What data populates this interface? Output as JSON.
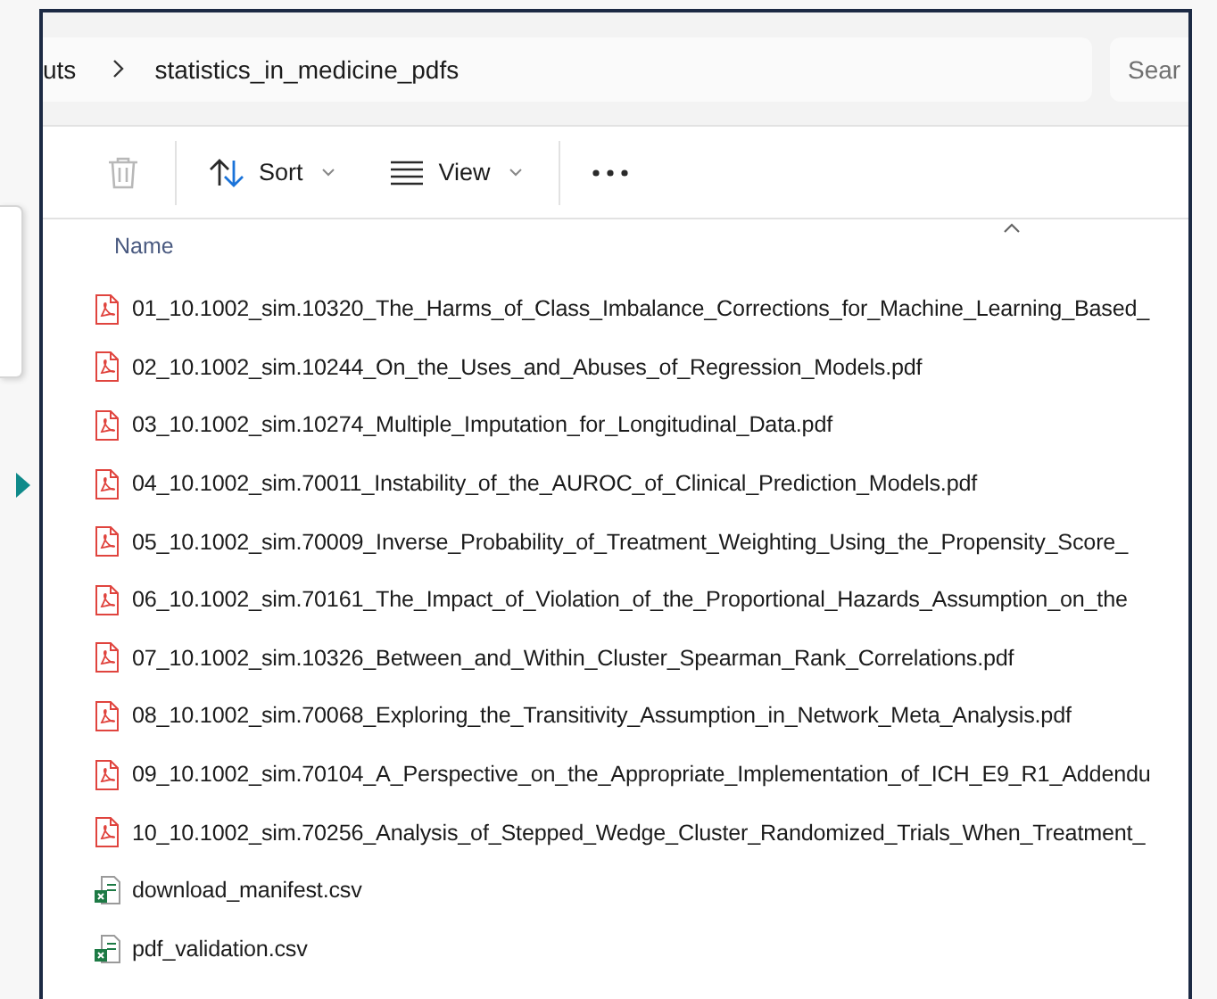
{
  "address_bar": {
    "breadcrumb": [
      {
        "label": "uts"
      },
      {
        "label": "statistics_in_medicine_pdfs"
      }
    ],
    "search": {
      "placeholder": "Sear"
    }
  },
  "toolbar": [
    {
      "kind": "delete",
      "disabled": true
    },
    {
      "kind": "sort",
      "label": "Sort",
      "disabled": false
    },
    {
      "kind": "view",
      "label": "View",
      "disabled": false
    },
    {
      "kind": "more",
      "disabled": false
    }
  ],
  "columns": [
    {
      "label": "Name",
      "sort_ascending": true
    }
  ],
  "files": [
    {
      "name": "01_10.1002_sim.10320_The_Harms_of_Class_Imbalance_Corrections_for_Machine_Learning_Based_",
      "kind": "pdf"
    },
    {
      "name": "02_10.1002_sim.10244_On_the_Uses_and_Abuses_of_Regression_Models.pdf",
      "kind": "pdf"
    },
    {
      "name": "03_10.1002_sim.10274_Multiple_Imputation_for_Longitudinal_Data.pdf",
      "kind": "pdf"
    },
    {
      "name": "04_10.1002_sim.70011_Instability_of_the_AUROC_of_Clinical_Prediction_Models.pdf",
      "kind": "pdf"
    },
    {
      "name": "05_10.1002_sim.70009_Inverse_Probability_of_Treatment_Weighting_Using_the_Propensity_Score_",
      "kind": "pdf"
    },
    {
      "name": "06_10.1002_sim.70161_The_Impact_of_Violation_of_the_Proportional_Hazards_Assumption_on_the",
      "kind": "pdf"
    },
    {
      "name": "07_10.1002_sim.10326_Between_and_Within_Cluster_Spearman_Rank_Correlations.pdf",
      "kind": "pdf"
    },
    {
      "name": "08_10.1002_sim.70068_Exploring_the_Transitivity_Assumption_in_Network_Meta_Analysis.pdf",
      "kind": "pdf"
    },
    {
      "name": "09_10.1002_sim.70104_A_Perspective_on_the_Appropriate_Implementation_of_ICH_E9_R1_Addendu",
      "kind": "pdf"
    },
    {
      "name": "10_10.1002_sim.70256_Analysis_of_Stepped_Wedge_Cluster_Randomized_Trials_When_Treatment_",
      "kind": "pdf"
    },
    {
      "name": "download_manifest.csv",
      "kind": "csv"
    },
    {
      "name": "pdf_validation.csv",
      "kind": "csv"
    }
  ]
}
